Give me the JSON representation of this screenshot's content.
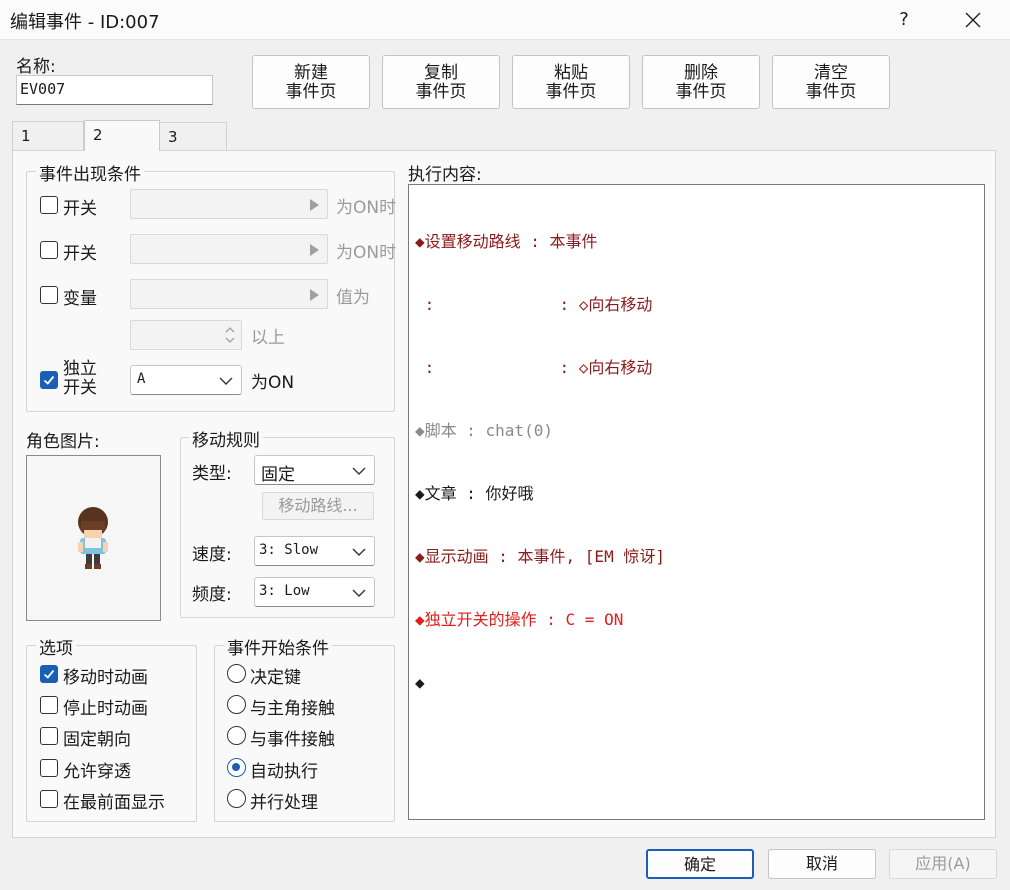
{
  "window": {
    "title": "编辑事件 - ID:007",
    "help": "?"
  },
  "name": {
    "label": "名称:",
    "value": "EV007"
  },
  "toolbar": [
    {
      "line1": "新建",
      "line2": "事件页"
    },
    {
      "line1": "复制",
      "line2": "事件页"
    },
    {
      "line1": "粘贴",
      "line2": "事件页"
    },
    {
      "line1": "删除",
      "line2": "事件页"
    },
    {
      "line1": "清空",
      "line2": "事件页"
    }
  ],
  "tabs": [
    "1",
    "2",
    "3"
  ],
  "active_tab": "2",
  "conditions": {
    "title": "事件出现条件",
    "switch1": {
      "label": "开关",
      "suffix": "为ON时",
      "checked": false
    },
    "switch2": {
      "label": "开关",
      "suffix": "为ON时",
      "checked": false
    },
    "variable": {
      "label": "变量",
      "suffix": "值为",
      "suffix2": "以上",
      "checked": false
    },
    "self_switch": {
      "label1": "独立",
      "label2": "开关",
      "value": "A",
      "suffix": "为ON",
      "checked": true
    }
  },
  "graphic": {
    "label": "角色图片:"
  },
  "movement": {
    "title": "移动规则",
    "type_label": "类型:",
    "type_value": "固定",
    "route_button": "移动路线...",
    "speed_label": "速度:",
    "speed_value": "3: Slow",
    "freq_label": "频度:",
    "freq_value": "3: Low"
  },
  "options": {
    "title": "选项",
    "items": [
      {
        "label": "移动时动画",
        "checked": true
      },
      {
        "label": "停止时动画",
        "checked": false
      },
      {
        "label": "固定朝向",
        "checked": false
      },
      {
        "label": "允许穿透",
        "checked": false
      },
      {
        "label": "在最前面显示",
        "checked": false
      }
    ]
  },
  "trigger": {
    "title": "事件开始条件",
    "items": [
      {
        "label": "决定键",
        "checked": false
      },
      {
        "label": "与主角接触",
        "checked": false
      },
      {
        "label": "与事件接触",
        "checked": false
      },
      {
        "label": "自动执行",
        "checked": true
      },
      {
        "label": "并行处理",
        "checked": false
      }
    ]
  },
  "contents": {
    "label": "执行内容:",
    "lines": [
      {
        "text": "◆设置移动路线 : 本事件",
        "color": "#8b1a1a"
      },
      {
        "text": " :             : ◇向右移动",
        "color": "#8b1a1a"
      },
      {
        "text": " :             : ◇向右移动",
        "color": "#8b1a1a"
      },
      {
        "text": "◆脚本 : chat(0)",
        "color": "#8a8a8a"
      },
      {
        "text": "◆文章 : 你好哦",
        "color": "#1a1a1a"
      },
      {
        "text": "◆显示动画 : 本事件, [EM 惊讶]",
        "color": "#8b1a1a"
      },
      {
        "text": "◆独立开关的操作 : C = ON",
        "color": "#e0201c"
      },
      {
        "text": "◆",
        "color": "#1a1a1a"
      }
    ]
  },
  "buttons": {
    "ok": "确定",
    "cancel": "取消",
    "apply": "应用(A)"
  },
  "colors": {
    "accent": "#1a5fb4",
    "dark_red": "#8b1a1a",
    "red": "#e0201c"
  }
}
